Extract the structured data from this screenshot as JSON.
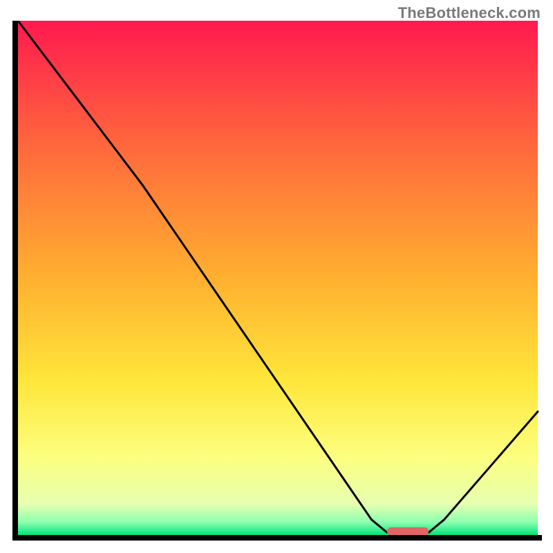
{
  "watermark": "TheBottleneck.com",
  "chart_data": {
    "type": "line",
    "title": "",
    "xlabel": "",
    "ylabel": "",
    "xlim": [
      0,
      100
    ],
    "ylim": [
      0,
      100
    ],
    "grid": false,
    "legend": false,
    "annotations": [],
    "tick_labels_visible": false,
    "gradient_stops": [
      {
        "offset": 0.0,
        "color": "#ff1a4f"
      },
      {
        "offset": 0.25,
        "color": "#ff6a3c"
      },
      {
        "offset": 0.5,
        "color": "#ffb030"
      },
      {
        "offset": 0.7,
        "color": "#ffe63a"
      },
      {
        "offset": 0.85,
        "color": "#fcff80"
      },
      {
        "offset": 0.94,
        "color": "#e6ffb0"
      },
      {
        "offset": 0.975,
        "color": "#8dffb0"
      },
      {
        "offset": 1.0,
        "color": "#00e47a"
      }
    ],
    "curve_points": [
      {
        "x": 0,
        "y": 100
      },
      {
        "x": 18,
        "y": 76
      },
      {
        "x": 24,
        "y": 68
      },
      {
        "x": 68,
        "y": 3
      },
      {
        "x": 71,
        "y": 0.5
      },
      {
        "x": 79,
        "y": 0.5
      },
      {
        "x": 82,
        "y": 3
      },
      {
        "x": 100,
        "y": 24
      }
    ],
    "marker": {
      "x_center": 75,
      "y": 0.7,
      "width": 8,
      "color": "#e06666"
    },
    "axes_color": "#000000",
    "curve_color": "#000000"
  }
}
